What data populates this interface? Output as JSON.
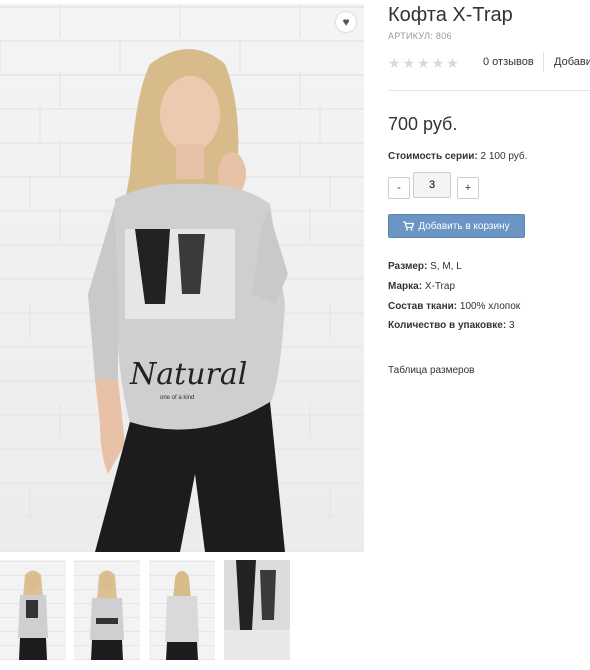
{
  "product": {
    "title": "Кофта X-Trap",
    "sku": "АРТИКУЛ: 806",
    "rating_stars": 0,
    "reviews": "0 отзывов",
    "add_review": "Добави",
    "price": "700 руб.",
    "series_label": "Стоимость серии:",
    "series_value": "2 100 руб.",
    "qty_minus": "-",
    "qty_value": "3",
    "qty_plus": "+",
    "cart_button": "Добавить в корзину",
    "size_table_link": "Таблица размеров"
  },
  "specs": [
    {
      "label": "Размер:",
      "value": "S, M, L"
    },
    {
      "label": "Марка:",
      "value": "X-Trap"
    },
    {
      "label": "Состав ткани:",
      "value": "100% хлопок"
    },
    {
      "label": "Количество в упаковке:",
      "value": "3"
    }
  ],
  "image": {
    "print_text": "Natural",
    "print_subtext": "one of a kind"
  },
  "icons": {
    "wishlist": "heart-icon",
    "cart": "cart-icon",
    "star": "star-icon"
  },
  "colors": {
    "accent": "#6a95c4",
    "star_empty": "#d9d9d9"
  }
}
